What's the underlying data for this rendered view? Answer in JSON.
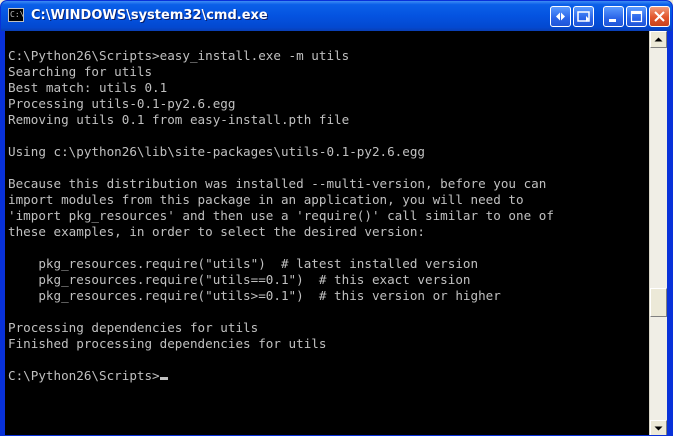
{
  "window": {
    "title": "C:\\WINDOWS\\system32\\cmd.exe",
    "app_icon_text": "C:\\"
  },
  "console": {
    "lines": [
      "C:\\Python26\\Scripts>easy_install.exe -m utils",
      "Searching for utils",
      "Best match: utils 0.1",
      "Processing utils-0.1-py2.6.egg",
      "Removing utils 0.1 from easy-install.pth file",
      "",
      "Using c:\\python26\\lib\\site-packages\\utils-0.1-py2.6.egg",
      "",
      "Because this distribution was installed --multi-version, before you can",
      "import modules from this package in an application, you will need to",
      "'import pkg_resources' and then use a 'require()' call similar to one of",
      "these examples, in order to select the desired version:",
      "",
      "    pkg_resources.require(\"utils\")  # latest installed version",
      "    pkg_resources.require(\"utils==0.1\")  # this exact version",
      "    pkg_resources.require(\"utils>=0.1\")  # this version or higher",
      "",
      "Processing dependencies for utils",
      "Finished processing dependencies for utils",
      "",
      "C:\\Python26\\Scripts>"
    ]
  },
  "scrollbar": {
    "position_fraction": 0.7
  },
  "colors": {
    "console_bg": "#000000",
    "console_text": "#c0c0c0",
    "titlebar_blue": "#0453e0",
    "close_red": "#e2552b"
  }
}
